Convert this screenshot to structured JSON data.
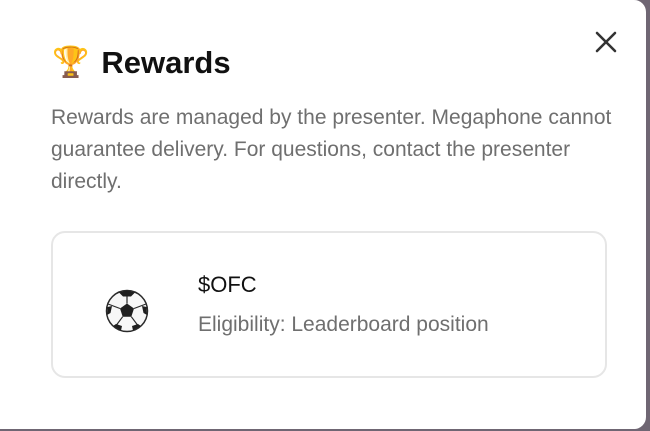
{
  "dialog": {
    "title_icon": "trophy-icon",
    "title": "Rewards",
    "description": "Rewards are managed by the presenter. Megaphone cannot guarantee delivery. For questions, contact the presenter directly.",
    "close_icon": "close-icon"
  },
  "rewards": [
    {
      "icon": "soccer-ball-icon",
      "name": "$OFC",
      "eligibility": "Eligibility: Leaderboard position"
    }
  ],
  "colors": {
    "backdrop": "#6f6673",
    "title": "#111111",
    "muted_text": "#6f6f6f",
    "card_border": "#e6e6e6"
  }
}
